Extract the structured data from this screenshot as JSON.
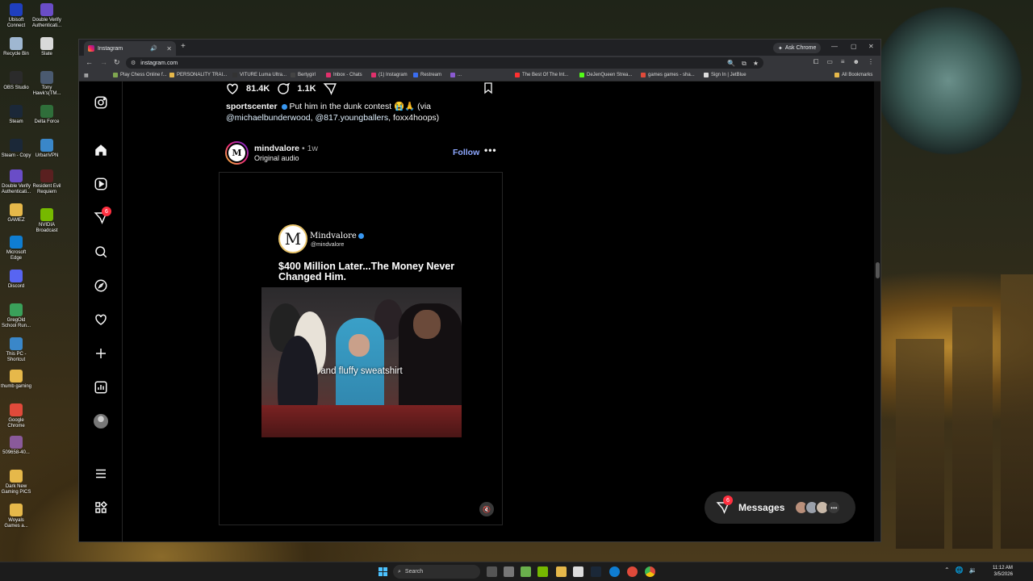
{
  "desktop": {
    "icons": [
      {
        "label": "Ubisoft Connect",
        "color": "#1f3fbf"
      },
      {
        "label": "Double Verify Authenticati...",
        "color": "#6a4dc7"
      },
      {
        "label": "Recycle Bin",
        "color": "#9fb7d1"
      },
      {
        "label": "Slate",
        "color": "#d9d9d9"
      },
      {
        "label": "OBS Studio",
        "color": "#2b2b2b"
      },
      {
        "label": "Tony Hawk's(TM...",
        "color": "#4a5a70"
      },
      {
        "label": "Steam",
        "color": "#1b2838"
      },
      {
        "label": "Delta Force",
        "color": "#2f6e3a"
      },
      {
        "label": "Steam - Copy",
        "color": "#1b2838"
      },
      {
        "label": "UrbanVPN",
        "color": "#3a87c9"
      },
      {
        "label": "Double Verify Authenticati...",
        "color": "#6a4dc7"
      },
      {
        "label": "Resident Evil Requiem",
        "color": "#5a2020"
      },
      {
        "label": "GAMEZ",
        "color": "#e6b84a"
      },
      {
        "label": "NVIDIA Broadcast",
        "color": "#76b900"
      },
      {
        "label": "Microsoft Edge",
        "color": "#0f7dd1"
      },
      {
        "label": "Discord",
        "color": "#5865f2"
      },
      {
        "label": "GregOld School Run...",
        "color": "#3aa05a"
      },
      {
        "label": "This PC - Shortcut",
        "color": "#3a87c9"
      },
      {
        "label": "thumb gaming",
        "color": "#e6b84a"
      },
      {
        "label": "Google Chrome",
        "color": "#e04a3a"
      },
      {
        "label": "509658-40...",
        "color": "#8a5a9a"
      },
      {
        "label": "Dark New Gaming PICS",
        "color": "#e6b84a"
      },
      {
        "label": "Woyals Games a...",
        "color": "#e6b84a"
      }
    ]
  },
  "browser": {
    "tab_title": "Instagram",
    "new_tab": "+",
    "ask_chrome": "Ask Chrome",
    "url": "instagram.com",
    "bookmarks": [
      {
        "label": "Play Chess Online f...",
        "color": "#7fa650"
      },
      {
        "label": "PERSONALITY TRAI...",
        "color": "#e6b84a"
      },
      {
        "label": "VITURE Luma Ultra...",
        "color": "#333"
      },
      {
        "label": "Bertygirl",
        "color": "#444"
      },
      {
        "label": "Inbox - Chats",
        "color": "#e1306c"
      },
      {
        "label": "(1) Instagram",
        "color": "#e1306c"
      },
      {
        "label": "Restream",
        "color": "#3a6df0"
      },
      {
        "label": "...",
        "color": "#8a5ad0"
      },
      {
        "label": "The Best Of The Int...",
        "color": "#ff3030"
      },
      {
        "label": "DeJenQueen Strea...",
        "color": "#53fc18"
      },
      {
        "label": "games games - sha...",
        "color": "#e04a3a"
      },
      {
        "label": "Sign In | JetBlue",
        "color": "#ddd"
      },
      {
        "label": "All Bookmarks",
        "color": "#e6b84a"
      }
    ]
  },
  "instagram": {
    "sidebar_badge": "6",
    "prev_post": {
      "likes": "81.4K",
      "comments": "1.1K",
      "caption_user": "sportscenter",
      "caption_text": "Put him in the dunk contest 😭🙏 (via",
      "mention1": "@michaelbunderwood",
      "sep1": ",",
      "mention2": "@817.youngballers",
      "sep2": ",",
      "mention3": "foxx4hoops)"
    },
    "post": {
      "avatar_letter": "M",
      "username": "mindvalore",
      "dot": "•",
      "time": "1w",
      "audio": "Original audio",
      "follow": "Follow",
      "more": "•••",
      "video": {
        "brand_letter": "M",
        "brand_name": "Mindvalore",
        "handle": "@mindvalore",
        "headline": "$400 Million Later...The Money Never Changed Him.",
        "subtitle": "and fluffy sweatshirt"
      }
    },
    "messages": {
      "label": "Messages",
      "badge": "6",
      "more": "•••"
    }
  },
  "taskbar": {
    "search": "Search",
    "time": "11:12 AM",
    "date": "3/5/2026"
  }
}
